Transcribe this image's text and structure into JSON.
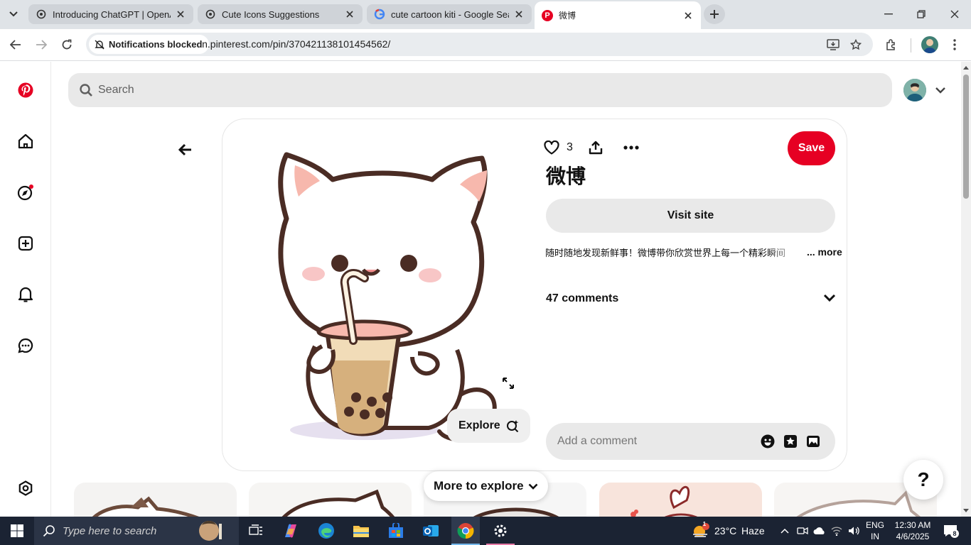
{
  "browser": {
    "tabs": [
      {
        "title": "Introducing ChatGPT | OpenAI",
        "icon": "openai-icon",
        "active": false
      },
      {
        "title": "Cute Icons Suggestions",
        "icon": "openai-icon",
        "active": false
      },
      {
        "title": "cute cartoon kiti - Google Search",
        "icon": "google-icon",
        "active": false
      },
      {
        "title": "微博",
        "icon": "pinterest-icon",
        "active": true
      }
    ],
    "notification_chip": "Notifications blocked",
    "url": "in.pinterest.com/pin/370421138101454562/"
  },
  "search": {
    "placeholder": "Search"
  },
  "pin": {
    "like_count": "3",
    "save_label": "Save",
    "title": "微博",
    "visit_label": "Visit site",
    "description": "随时随地发现新鲜事！微博带你欣赏世界上每一个精彩瞬间",
    "more_label": "... more",
    "comments_label": "47 comments",
    "comment_placeholder": "Add a comment",
    "explore_label": "Explore"
  },
  "more_to_explore": "More to explore",
  "help_label": "?",
  "colors": {
    "brand": "#e60023",
    "taskbar": "#1b2333"
  },
  "taskbar": {
    "search_placeholder": "Type here to search",
    "weather_temp": "23°C",
    "weather_desc": "Haze",
    "weather_badge": "1",
    "lang_top": "ENG",
    "lang_bottom": "IN",
    "time": "12:30 AM",
    "date": "4/6/2025",
    "notification_count": "8"
  }
}
